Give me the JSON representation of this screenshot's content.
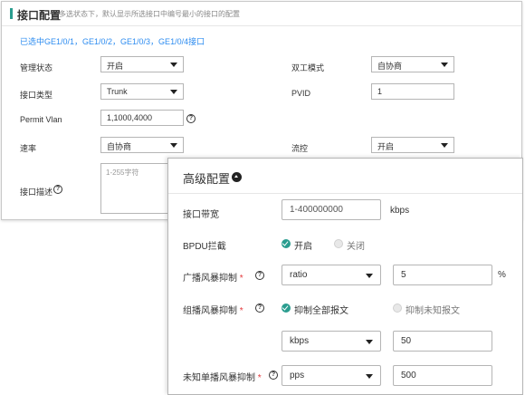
{
  "interface": {
    "title": "接口配置",
    "hint": "多选状态下，默认显示所选接口中编号最小的接口的配置",
    "selected_info": "已选中GE1/0/1，GE1/0/2，GE1/0/3，GE1/0/4接口",
    "admin_status": {
      "label": "管理状态",
      "value": "开启"
    },
    "duplex": {
      "label": "双工模式",
      "value": "自协商"
    },
    "port_type": {
      "label": "接口类型",
      "value": "Trunk"
    },
    "pvid": {
      "label": "PVID",
      "value": "1"
    },
    "permit_vlan": {
      "label": "Permit Vlan",
      "value": "1,1000,4000"
    },
    "speed": {
      "label": "速率",
      "value": "自协商"
    },
    "flow_control": {
      "label": "流控",
      "value": "开启"
    },
    "description": {
      "label": "接口描述",
      "placeholder": "1-255字符"
    }
  },
  "advanced": {
    "title": "高级配置",
    "bandwidth": {
      "label": "接口带宽",
      "placeholder": "1-400000000",
      "unit": "kbps"
    },
    "bpdu": {
      "label": "BPDU拦截",
      "options": [
        "开启",
        "关闭"
      ],
      "selected": "开启"
    },
    "broadcast": {
      "label": "广播风暴抑制",
      "required_mark": "*",
      "mode": "ratio",
      "value": "5",
      "unit": "%"
    },
    "multicast": {
      "label": "组播风暴抑制",
      "required_mark": "*",
      "options": [
        "抑制全部报文",
        "抑制未知报文"
      ],
      "selected": "抑制全部报文",
      "mode": "kbps",
      "value": "50"
    },
    "unknown_unicast": {
      "label": "未知单播风暴抑制",
      "required_mark": "*",
      "mode": "pps",
      "value": "500"
    }
  },
  "icons": {
    "help": "question-circle-icon",
    "collapse": "chevron-up-circle-icon",
    "caret": "caret-down-icon"
  },
  "colors": {
    "accent": "#2a9d8f",
    "link": "#2d8cf0",
    "required": "#e4393c"
  }
}
